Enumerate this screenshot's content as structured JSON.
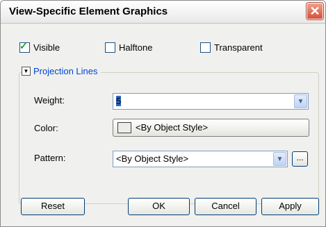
{
  "window": {
    "title": "View-Specific Element Graphics",
    "close_glyph": "✕"
  },
  "checkboxes": [
    {
      "label": "Visible",
      "checked": true
    },
    {
      "label": "Halftone",
      "checked": false
    },
    {
      "label": "Transparent",
      "checked": false
    }
  ],
  "group": {
    "title": "Projection Lines",
    "weight_label": "Weight:",
    "weight_value": "5",
    "color_label": "Color:",
    "color_value": "<By Object Style>",
    "pattern_label": "Pattern:",
    "pattern_value": "<By Object Style>",
    "browse_label": "..."
  },
  "buttons": {
    "reset": "Reset",
    "ok": "OK",
    "cancel": "Cancel",
    "apply": "Apply"
  },
  "icons": {
    "check": "check-icon",
    "collapse": "collapse-arrow-icon",
    "dropdown": "chevron-down-icon",
    "close": "close-icon"
  },
  "colors": {
    "link_blue": "#0046d5",
    "check_green": "#21a121",
    "close_red": "#d4503a",
    "selection_blue": "#316ac5"
  }
}
